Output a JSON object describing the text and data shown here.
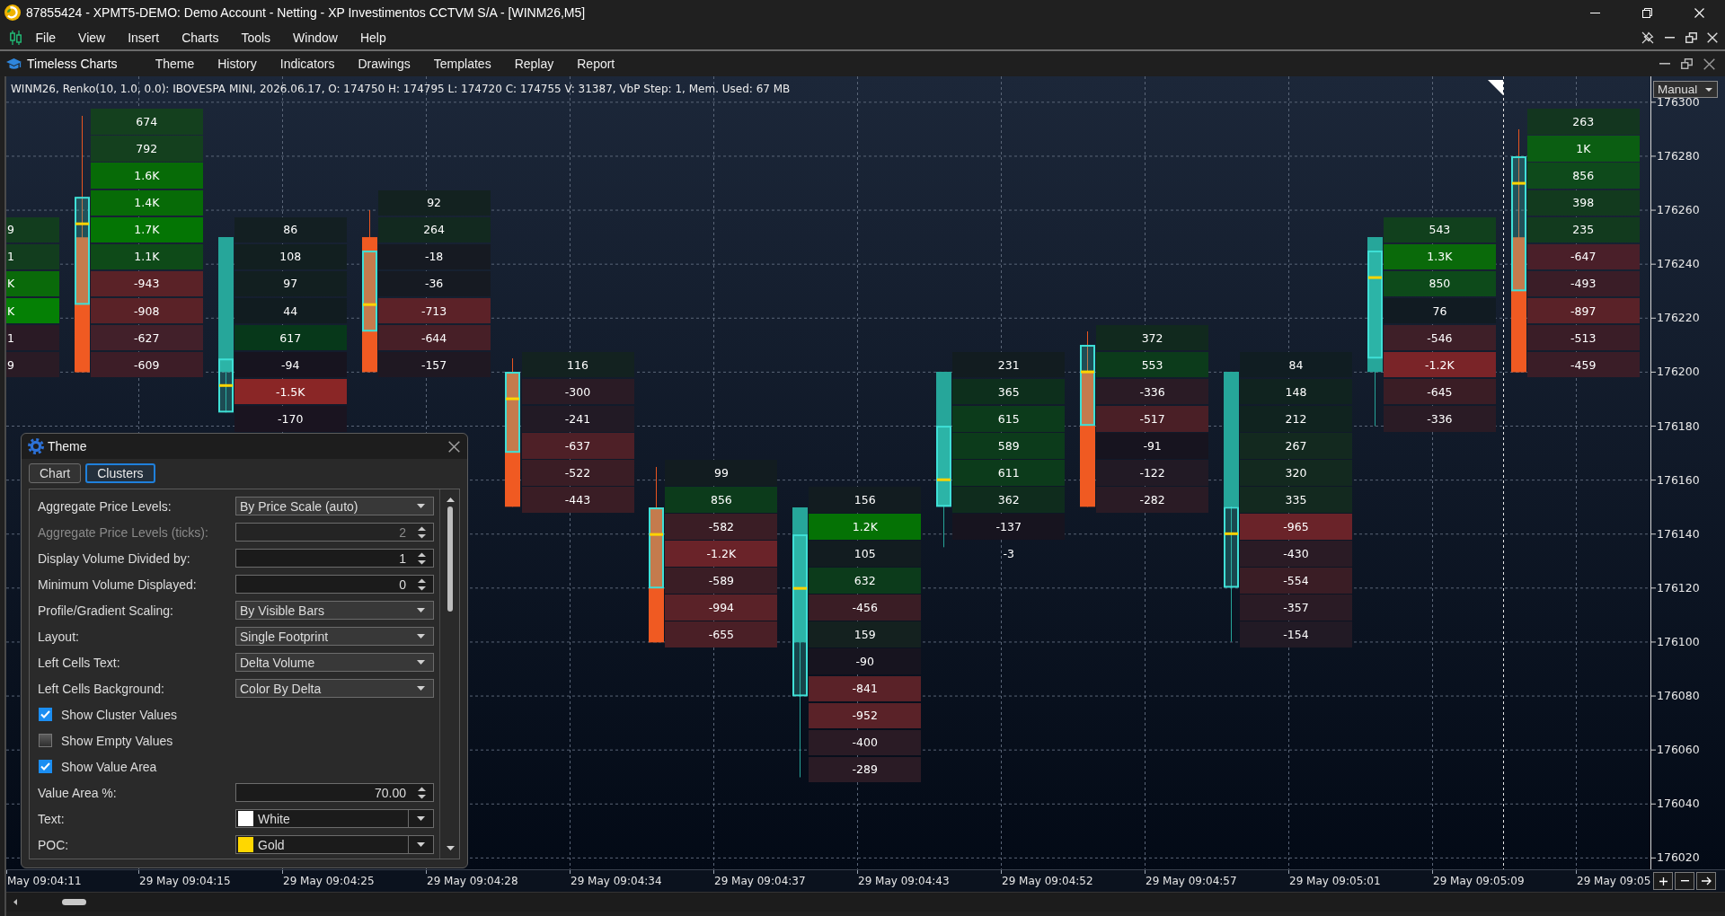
{
  "window": {
    "title": "87855424 - XPMT5-DEMO: Demo Account - Netting - XP Investimentos CCTVM S/A - [WINM26,M5]"
  },
  "menu_bar": [
    "File",
    "View",
    "Insert",
    "Charts",
    "Tools",
    "Window",
    "Help"
  ],
  "chart_window": {
    "title": "Timeless Charts",
    "menu": [
      "Theme",
      "History",
      "Indicators",
      "Drawings",
      "Templates",
      "Replay",
      "Report"
    ],
    "info_line": "WINM26, Renko(10, 1.0, 0.0): IBOVESPA MINI, 2026.06.17, O: 174750 H: 174795 L: 174720 C: 174755 V: 31387, VbP Step: 1, Mem. Used: 67 MB",
    "scale_mode": "Manual"
  },
  "footprint_chart": {
    "price_ticks": [
      "176300",
      "176280",
      "176260",
      "176240",
      "176220",
      "176200",
      "176180",
      "176160",
      "176140",
      "176120",
      "176100",
      "176080",
      "176060",
      "176040",
      "176020"
    ],
    "time_labels": [
      "May 09:04:11",
      "29 May 09:04:15",
      "29 May 09:04:25",
      "29 May 09:04:28",
      "29 May 09:04:34",
      "29 May 09:04:37",
      "29 May 09:04:43",
      "29 May 09:04:52",
      "29 May 09:04:57",
      "29 May 09:05:01",
      "29 May 09:05:09",
      "29 May 09:05"
    ],
    "columns": [
      {
        "cells": [
          {
            "text": "9",
            "color": "#123d1e"
          },
          {
            "text": "1",
            "color": "#123d1e"
          },
          {
            "text": "K",
            "color": "#0a6a0a"
          },
          {
            "text": "K",
            "color": "#058005"
          },
          {
            "text": "1",
            "color": "#2a1a25"
          },
          {
            "text": "9",
            "color": "#2a1b25"
          }
        ]
      },
      {
        "candle": {
          "kind": "down"
        },
        "cells": [
          {
            "text": "674",
            "color": "#14401e"
          },
          {
            "text": "792",
            "color": "#14401e"
          },
          {
            "text": "1.6K",
            "color": "#076b07"
          },
          {
            "text": "1.4K",
            "color": "#076b07"
          },
          {
            "text": "1.7K",
            "color": "#047504"
          },
          {
            "text": "1.1K",
            "color": "#0e4a18"
          },
          {
            "text": "-943",
            "color": "#5a2227"
          },
          {
            "text": "-908",
            "color": "#5a2227"
          },
          {
            "text": "-627",
            "color": "#42202a"
          },
          {
            "text": "-609",
            "color": "#3d1d27"
          }
        ]
      },
      {
        "candle": {
          "kind": "up"
        },
        "cells": [
          {
            "text": "86",
            "color": "#131f22"
          },
          {
            "text": "108",
            "color": "#121f20"
          },
          {
            "text": "97",
            "color": "#121f20"
          },
          {
            "text": "44",
            "color": "#111c20"
          },
          {
            "text": "617",
            "color": "#07381a"
          },
          {
            "text": "-94",
            "color": "#17141f"
          },
          {
            "text": "-1.5K",
            "color": "#8a2626"
          },
          {
            "text": "-170",
            "color": "#1a1420"
          }
        ]
      },
      {
        "candle": {
          "kind": "down"
        },
        "cells": [
          {
            "text": "92",
            "color": "#132220"
          },
          {
            "text": "264",
            "color": "#12291f"
          },
          {
            "text": "-18",
            "color": "#161a22"
          },
          {
            "text": "-36",
            "color": "#161a22"
          },
          {
            "text": "-713",
            "color": "#5c2228"
          },
          {
            "text": "-644",
            "color": "#471f27"
          },
          {
            "text": "-157",
            "color": "#1f1822"
          }
        ]
      },
      {
        "candle": {
          "kind": "down"
        },
        "cells": [
          {
            "text": "116",
            "color": "#132220"
          },
          {
            "text": "-300",
            "color": "#2a1b25"
          },
          {
            "text": "-241",
            "color": "#221a25"
          },
          {
            "text": "-637",
            "color": "#4e2027"
          },
          {
            "text": "-522",
            "color": "#3a1d25"
          },
          {
            "text": "-443",
            "color": "#3a1d25"
          }
        ]
      },
      {
        "candle": {
          "kind": "down"
        },
        "cells": [
          {
            "text": "99",
            "color": "#121c20"
          },
          {
            "text": "856",
            "color": "#0c3b1b"
          },
          {
            "text": "-582",
            "color": "#3a1d25"
          },
          {
            "text": "-1.2K",
            "color": "#6a2329"
          },
          {
            "text": "-589",
            "color": "#3a1d25"
          },
          {
            "text": "-994",
            "color": "#5a2228"
          },
          {
            "text": "-655",
            "color": "#4a1f26"
          }
        ]
      },
      {
        "candle": {
          "kind": "up"
        },
        "cells": [
          {
            "text": "156",
            "color": "#121c20"
          },
          {
            "text": "1.2K",
            "color": "#057205"
          },
          {
            "text": "105",
            "color": "#121c20"
          },
          {
            "text": "632",
            "color": "#0c3b1b"
          },
          {
            "text": "-456",
            "color": "#3a1d25"
          },
          {
            "text": "159",
            "color": "#14211f"
          },
          {
            "text": "-90",
            "color": "#17141f"
          },
          {
            "text": "-841",
            "color": "#5a2228"
          },
          {
            "text": "-952",
            "color": "#5a2228"
          },
          {
            "text": "-400",
            "color": "#2a1b25"
          },
          {
            "text": "-289",
            "color": "#2a1b25"
          }
        ]
      },
      {
        "candle": {
          "kind": "up"
        },
        "cells": [
          {
            "text": "231",
            "color": "#121c20"
          },
          {
            "text": "365",
            "color": "#0d2f1c"
          },
          {
            "text": "615",
            "color": "#0c3b1b"
          },
          {
            "text": "589",
            "color": "#0c3b1b"
          },
          {
            "text": "611",
            "color": "#0c3b1b"
          },
          {
            "text": "362",
            "color": "#0f2c1d"
          },
          {
            "text": "-137",
            "color": "#17141f"
          },
          {
            "text": "-3"
          }
        ]
      },
      {
        "candle": {
          "kind": "down"
        },
        "cells": [
          {
            "text": "372",
            "color": "#11291e"
          },
          {
            "text": "553",
            "color": "#0c3b1b"
          },
          {
            "text": "-336",
            "color": "#2a1b25"
          },
          {
            "text": "-517",
            "color": "#4a1f26"
          },
          {
            "text": "-91",
            "color": "#17141f"
          },
          {
            "text": "-122",
            "color": "#221a25"
          },
          {
            "text": "-282",
            "color": "#2a1b25"
          }
        ]
      },
      {
        "candle": {
          "kind": "up"
        },
        "cells": [
          {
            "text": "84",
            "color": "#101d22"
          },
          {
            "text": "148",
            "color": "#10231f"
          },
          {
            "text": "212",
            "color": "#10231f"
          },
          {
            "text": "267",
            "color": "#13291f"
          },
          {
            "text": "320",
            "color": "#13291f"
          },
          {
            "text": "335",
            "color": "#13291f"
          },
          {
            "text": "-965",
            "color": "#6a2329"
          },
          {
            "text": "-430",
            "color": "#2a1b25"
          },
          {
            "text": "-554",
            "color": "#3a1d25"
          },
          {
            "text": "-357",
            "color": "#2a1b25"
          },
          {
            "text": "-154",
            "color": "#221a25"
          }
        ]
      },
      {
        "candle": {
          "kind": "up"
        },
        "cells": [
          {
            "text": "543",
            "color": "#11401d"
          },
          {
            "text": "1.3K",
            "color": "#0a6a0a"
          },
          {
            "text": "850",
            "color": "#0d4a1a"
          },
          {
            "text": "76",
            "color": "#111b22"
          },
          {
            "text": "-546",
            "color": "#3e1f28"
          },
          {
            "text": "-1.2K",
            "color": "#7a2428"
          },
          {
            "text": "-645",
            "color": "#3a1d25"
          },
          {
            "text": "-336",
            "color": "#2a1b25"
          }
        ]
      },
      {
        "candle": {
          "kind": "down"
        },
        "cells": [
          {
            "text": "263",
            "color": "#13361f"
          },
          {
            "text": "1K",
            "color": "#0b5e12"
          },
          {
            "text": "856",
            "color": "#0e4a1b"
          },
          {
            "text": "398",
            "color": "#123a1e"
          },
          {
            "text": "235",
            "color": "#123a1e"
          },
          {
            "text": "-647",
            "color": "#4a1f29"
          },
          {
            "text": "-493",
            "color": "#3a1d27"
          },
          {
            "text": "-897",
            "color": "#5a2228"
          },
          {
            "text": "-513",
            "color": "#3a1d27"
          },
          {
            "text": "-459",
            "color": "#3a1d27"
          }
        ]
      }
    ]
  },
  "theme_dialog": {
    "title": "Theme",
    "tabs": [
      {
        "label": "Chart",
        "selected": false
      },
      {
        "label": "Clusters",
        "selected": true
      }
    ],
    "settings": [
      {
        "kind": "dropdown",
        "label": "Aggregate Price Levels:",
        "value": "By Price Scale (auto)",
        "disabled": false
      },
      {
        "kind": "spinner",
        "label": "Aggregate Price Levels (ticks):",
        "value": "2",
        "disabled": true
      },
      {
        "kind": "spinner",
        "label": "Display Volume Divided by:",
        "value": "1",
        "disabled": false
      },
      {
        "kind": "spinner",
        "label": "Minimum Volume Displayed:",
        "value": "0",
        "disabled": false
      },
      {
        "kind": "dropdown",
        "label": "Profile/Gradient Scaling:",
        "value": "By Visible Bars",
        "disabled": false
      },
      {
        "kind": "dropdown",
        "label": "Layout:",
        "value": "Single Footprint",
        "disabled": false
      },
      {
        "kind": "dropdown",
        "label": "Left Cells Text:",
        "value": "Delta Volume",
        "disabled": false
      },
      {
        "kind": "dropdown",
        "label": "Left Cells Background:",
        "value": "Color By Delta",
        "disabled": false
      },
      {
        "kind": "checkbox",
        "label": "Show Cluster Values",
        "checked": true,
        "disabled": false
      },
      {
        "kind": "checkbox",
        "label": "Show Empty Values",
        "checked": false,
        "disabled": false
      },
      {
        "kind": "checkbox",
        "label": "Show Value Area",
        "checked": true,
        "disabled": false
      },
      {
        "kind": "spinner",
        "label": "Value Area %:",
        "value": "70.00",
        "disabled": false
      },
      {
        "kind": "color",
        "label": "Text:",
        "value": "White",
        "color": "#ffffff",
        "disabled": false
      },
      {
        "kind": "color",
        "label": "POC:",
        "value": "Gold",
        "color": "#ffd700",
        "disabled": false
      }
    ]
  }
}
